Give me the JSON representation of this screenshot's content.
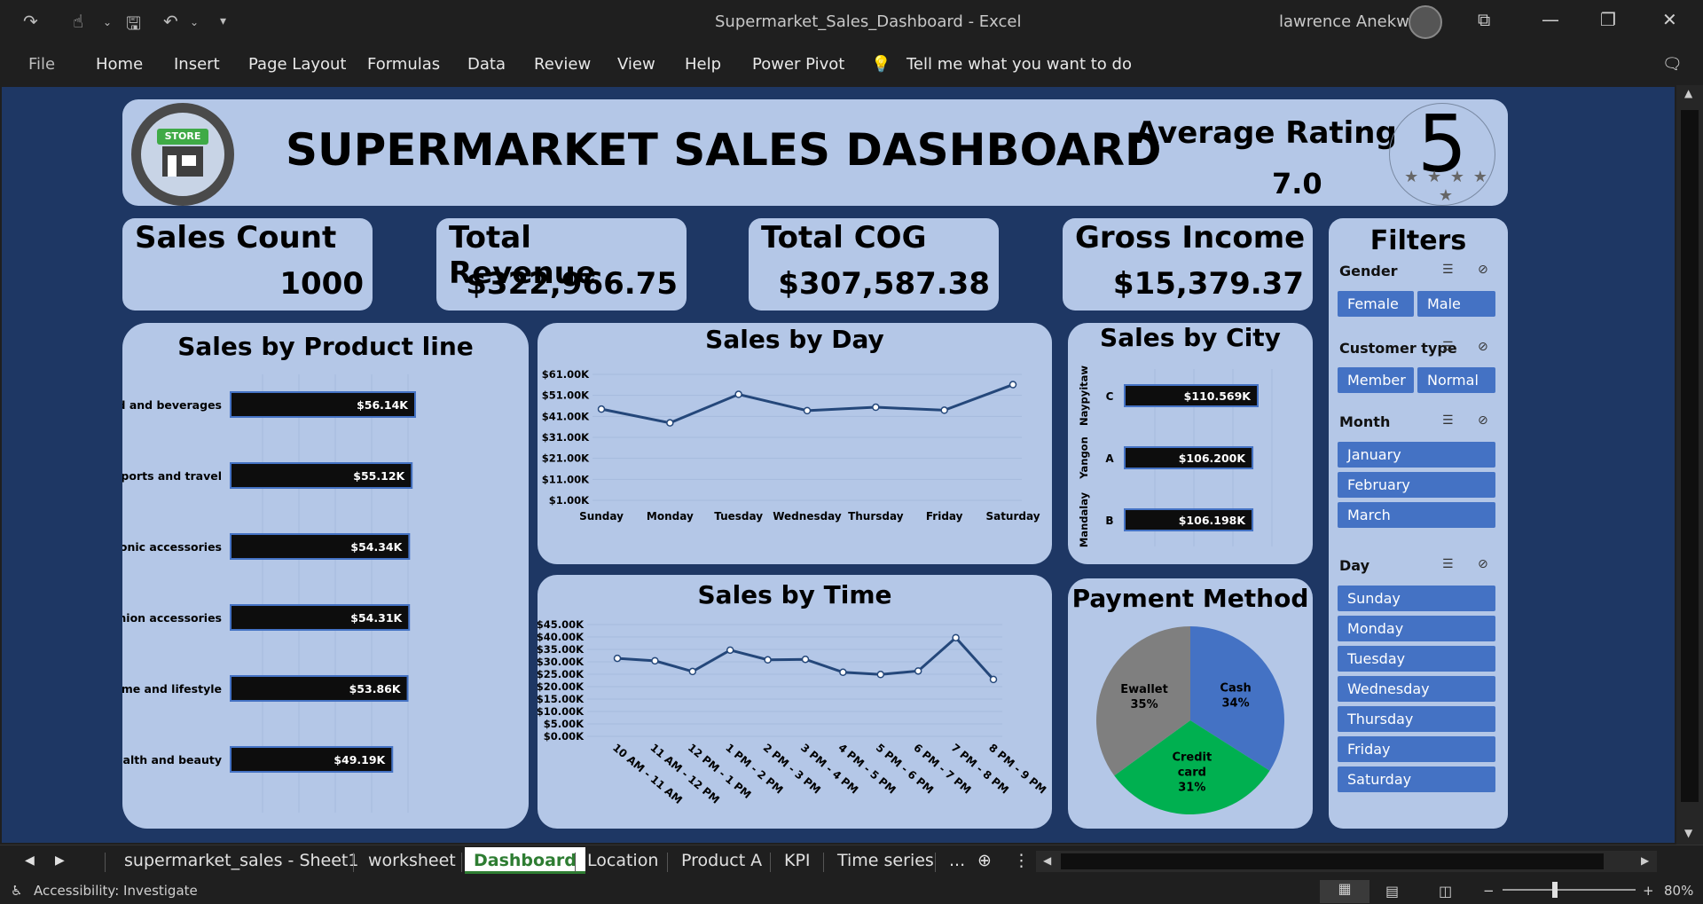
{
  "window": {
    "title": "Supermarket_Sales_Dashboard  -  Excel",
    "user": "lawrence Anekwe"
  },
  "menu": [
    "File",
    "Home",
    "Insert",
    "Page Layout",
    "Formulas",
    "Data",
    "Review",
    "View",
    "Help",
    "Power Pivot"
  ],
  "tell_me": "Tell me what you want to do",
  "dashboard": {
    "title": "SUPERMARKET SALES DASHBOARD",
    "logo_text": "STORE",
    "avg_rating_label": "Average  Rating",
    "avg_rating_value": "7.0",
    "rating_badge": "5"
  },
  "kpis": {
    "sales_count": {
      "label": "Sales Count",
      "value": "1000"
    },
    "total_revenue": {
      "label": "Total Revenue",
      "value": "$322,966.75"
    },
    "total_cog": {
      "label": "Total COG",
      "value": "$307,587.38"
    },
    "gross_income": {
      "label": "Gross Income",
      "value": "$15,379.37"
    }
  },
  "chart_data": [
    {
      "type": "bar",
      "title": "Sales by Product line",
      "categories": [
        "Food and beverages",
        "Sports and travel",
        "Electronic accessories",
        "Fashion accessories",
        "Home and lifestyle",
        "Health and beauty"
      ],
      "values": [
        56.14,
        55.12,
        54.34,
        54.31,
        53.86,
        49.19
      ],
      "labels": [
        "$56.14K",
        "$55.12K",
        "$54.34K",
        "$54.31K",
        "$53.86K",
        "$49.19K"
      ],
      "orientation": "horizontal",
      "bar_color": "#0d0d0d"
    },
    {
      "type": "line",
      "title": "Sales by Day",
      "categories": [
        "Sunday",
        "Monday",
        "Tuesday",
        "Wednesday",
        "Thursday",
        "Friday",
        "Saturday"
      ],
      "values": [
        44.46,
        37.9,
        51.48,
        43.73,
        45.35,
        43.93,
        56.12
      ],
      "yticks": [
        "$61.00K",
        "$51.00K",
        "$41.00K",
        "$31.00K",
        "$21.00K",
        "$11.00K",
        "$1.00K"
      ],
      "ylim": [
        1,
        61
      ],
      "line_color": "#24477a"
    },
    {
      "type": "line",
      "title": "Sales by Time",
      "categories": [
        "10 AM - 11 AM",
        "11 AM - 12 PM",
        "12 PM - 1 PM",
        "1 PM - 2 PM",
        "2 PM - 3 PM",
        "3 PM - 4 PM",
        "4 PM - 5 PM",
        "5 PM - 6 PM",
        "6 PM - 7 PM",
        "7 PM - 8 PM",
        "8 PM - 9 PM"
      ],
      "values": [
        31.4,
        30.4,
        26.1,
        34.7,
        30.8,
        31.0,
        25.8,
        24.9,
        26.3,
        39.7,
        22.9
      ],
      "yticks": [
        "$45.00K",
        "$40.00K",
        "$35.00K",
        "$30.00K",
        "$25.00K",
        "$20.00K",
        "$15.00K",
        "$10.00K",
        "$5.00K",
        "$0.00K"
      ],
      "ylim": [
        0,
        45
      ],
      "line_color": "#24477a"
    },
    {
      "type": "bar",
      "title": "Sales by City",
      "categories": [
        "Naypyitaw",
        "Yangon",
        "Mandalay"
      ],
      "branches": [
        "C",
        "A",
        "B"
      ],
      "values": [
        110.569,
        106.2,
        106.198
      ],
      "labels": [
        "$110.569K",
        "$106.200K",
        "$106.198K"
      ],
      "orientation": "horizontal",
      "bar_color": "#0d0d0d"
    },
    {
      "type": "pie",
      "title": "Payment Method",
      "slices": [
        {
          "label": "Cash",
          "pct_text": "34%",
          "value": 34,
          "color": "#4472c4"
        },
        {
          "label": "Credit card",
          "pct_text": "31%",
          "value": 31,
          "color": "#00b050"
        },
        {
          "label": "Ewallet",
          "pct_text": "35%",
          "value": 35,
          "color": "#7f7f7f"
        }
      ]
    }
  ],
  "filters": {
    "title": "Filters",
    "gender": {
      "label": "Gender",
      "options": [
        "Female",
        "Male"
      ]
    },
    "customer_type": {
      "label": "Customer type",
      "options": [
        "Member",
        "Normal"
      ]
    },
    "month": {
      "label": "Month",
      "options": [
        "January",
        "February",
        "March"
      ]
    },
    "day": {
      "label": "Day",
      "options": [
        "Sunday",
        "Monday",
        "Tuesday",
        "Wednesday",
        "Thursday",
        "Friday",
        "Saturday"
      ]
    }
  },
  "sheet_tabs": [
    "supermarket_sales - Sheet1",
    "worksheet",
    "Dashboard",
    "Location",
    "Product A",
    "KPI",
    "Time series",
    "..."
  ],
  "active_tab": "Dashboard",
  "status": {
    "accessibility": "Accessibility: Investigate",
    "zoom": "80%"
  }
}
